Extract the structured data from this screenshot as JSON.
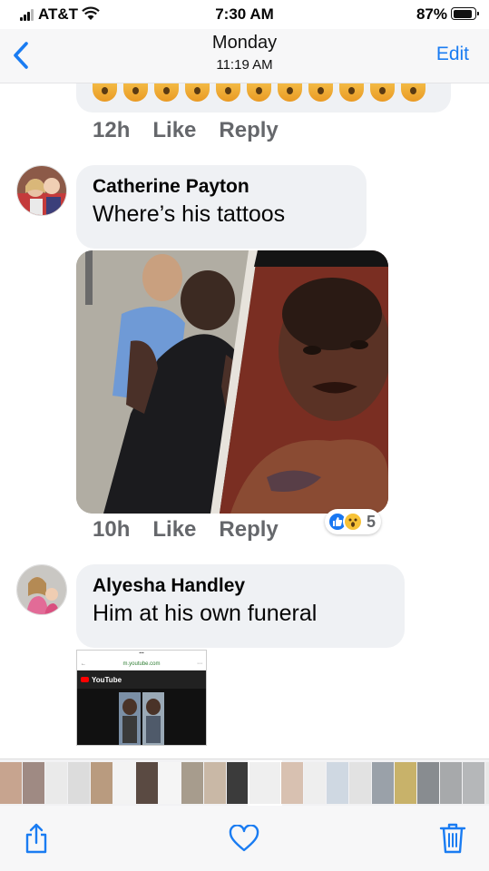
{
  "status_bar": {
    "carrier": "AT&T",
    "time": "7:30 AM",
    "battery": "87%",
    "battery_level": 0.87
  },
  "nav": {
    "title": "Monday",
    "subtitle": "11:19 AM",
    "edit_label": "Edit",
    "back_icon": "chevron-left-icon"
  },
  "comments": [
    {
      "time": "12h",
      "like": "Like",
      "reply": "Reply"
    },
    {
      "author": "Catherine Payton",
      "text": "Where’s his tattoos",
      "time": "10h",
      "like": "Like",
      "reply": "Reply",
      "reaction_count": "5",
      "reactions": [
        "like-icon",
        "wow-icon"
      ]
    },
    {
      "author": "Alyesha Handley",
      "text": "Him at his own funeral",
      "thumbnail": {
        "url": "m.youtube.com",
        "app": "YouTube"
      }
    }
  ],
  "toolbar": {
    "share_icon": "share-icon",
    "favorite_icon": "heart-icon",
    "delete_icon": "trash-icon"
  },
  "colors": {
    "accent": "#1a7cf2",
    "bubble": "#eff1f4",
    "meta_text": "#65676b"
  }
}
